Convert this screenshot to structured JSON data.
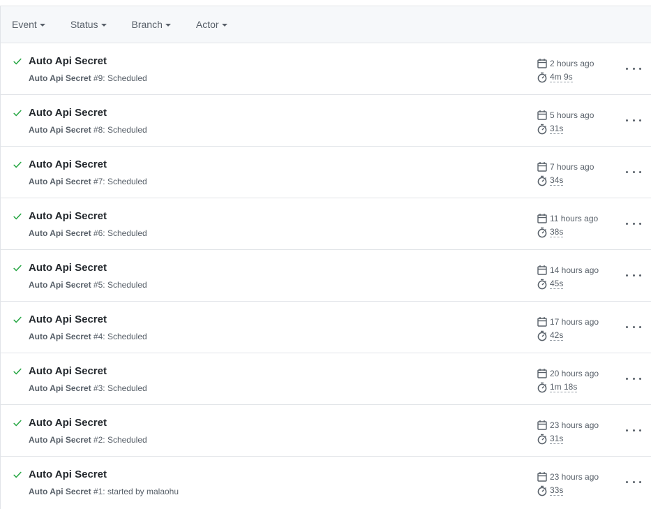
{
  "colors": {
    "success": "#28a745",
    "muted": "#586069",
    "border": "#e1e4e8",
    "header_bg": "#f6f8fa"
  },
  "filters": [
    {
      "label": "Event"
    },
    {
      "label": "Status"
    },
    {
      "label": "Branch"
    },
    {
      "label": "Actor"
    }
  ],
  "runs": [
    {
      "title": "Auto Api Secret",
      "workflow": "Auto Api Secret",
      "run_label": "#9",
      "trigger": ": Scheduled",
      "time_ago": "2 hours ago",
      "duration": "4m 9s",
      "status_icon": "check-icon"
    },
    {
      "title": "Auto Api Secret",
      "workflow": "Auto Api Secret",
      "run_label": "#8",
      "trigger": ": Scheduled",
      "time_ago": "5 hours ago",
      "duration": "31s",
      "status_icon": "check-icon"
    },
    {
      "title": "Auto Api Secret",
      "workflow": "Auto Api Secret",
      "run_label": "#7",
      "trigger": ": Scheduled",
      "time_ago": "7 hours ago",
      "duration": "34s",
      "status_icon": "check-icon"
    },
    {
      "title": "Auto Api Secret",
      "workflow": "Auto Api Secret",
      "run_label": "#6",
      "trigger": ": Scheduled",
      "time_ago": "11 hours ago",
      "duration": "38s",
      "status_icon": "check-icon"
    },
    {
      "title": "Auto Api Secret",
      "workflow": "Auto Api Secret",
      "run_label": "#5",
      "trigger": ": Scheduled",
      "time_ago": "14 hours ago",
      "duration": "45s",
      "status_icon": "check-icon"
    },
    {
      "title": "Auto Api Secret",
      "workflow": "Auto Api Secret",
      "run_label": "#4",
      "trigger": ": Scheduled",
      "time_ago": "17 hours ago",
      "duration": "42s",
      "status_icon": "check-icon"
    },
    {
      "title": "Auto Api Secret",
      "workflow": "Auto Api Secret",
      "run_label": "#3",
      "trigger": ": Scheduled",
      "time_ago": "20 hours ago",
      "duration": "1m 18s",
      "status_icon": "check-icon"
    },
    {
      "title": "Auto Api Secret",
      "workflow": "Auto Api Secret",
      "run_label": "#2",
      "trigger": ": Scheduled",
      "time_ago": "23 hours ago",
      "duration": "31s",
      "status_icon": "check-icon"
    },
    {
      "title": "Auto Api Secret",
      "workflow": "Auto Api Secret",
      "run_label": "#1",
      "trigger": ": started by malaohu",
      "time_ago": "23 hours ago",
      "duration": "33s",
      "status_icon": "check-icon"
    }
  ]
}
